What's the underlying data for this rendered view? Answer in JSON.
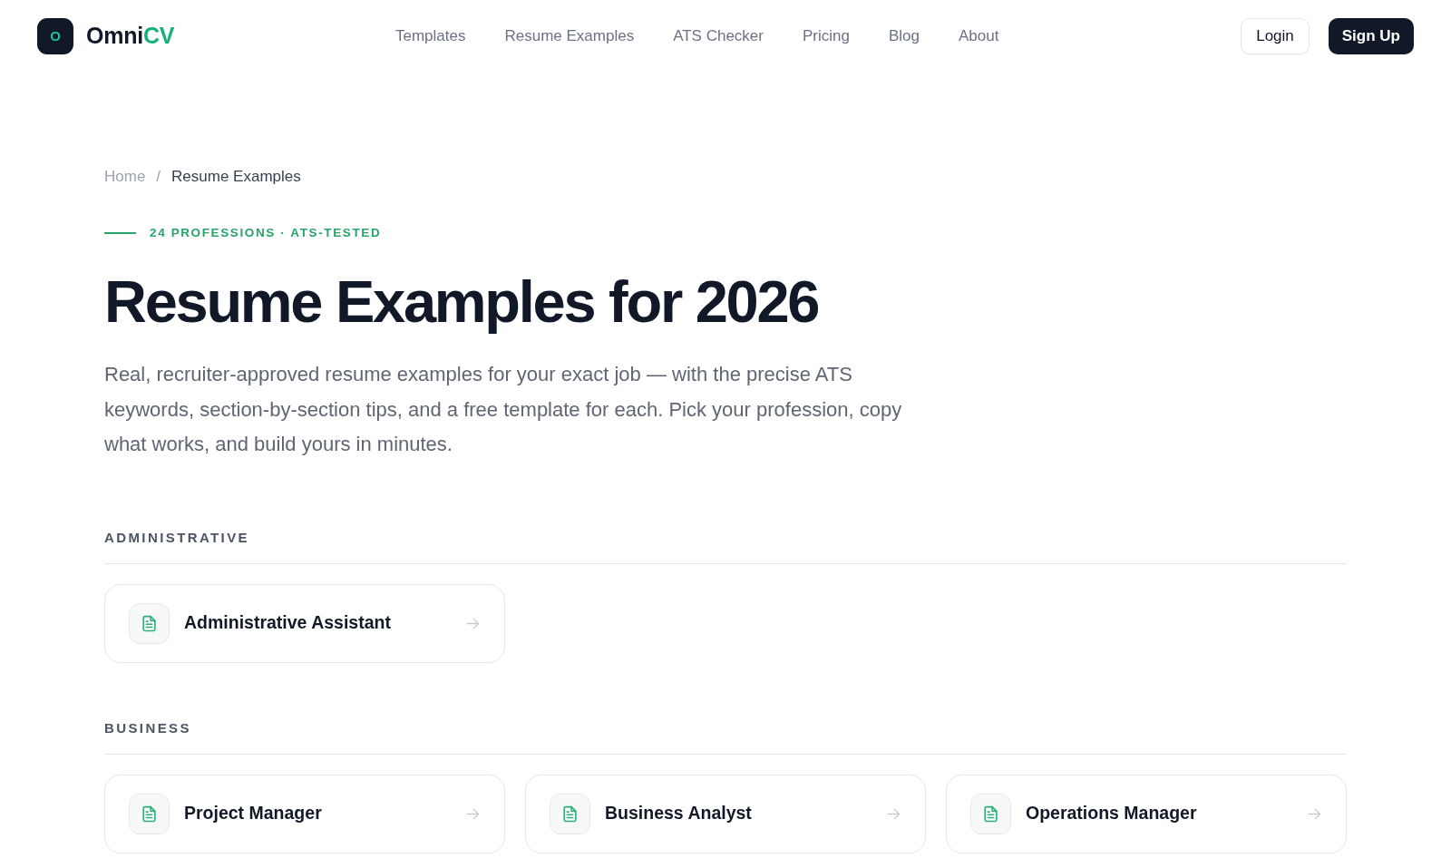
{
  "header": {
    "logo": {
      "mark": "O",
      "name": "Omni",
      "accent": "CV"
    },
    "nav": [
      {
        "label": "Templates"
      },
      {
        "label": "Resume Examples"
      },
      {
        "label": "ATS Checker"
      },
      {
        "label": "Pricing"
      },
      {
        "label": "Blog"
      },
      {
        "label": "About"
      }
    ],
    "login": "Login",
    "signup": "Sign Up"
  },
  "breadcrumb": {
    "separator": "/",
    "items": [
      {
        "label": "Home",
        "current": false
      },
      {
        "label": "Resume Examples",
        "current": true
      }
    ]
  },
  "hero": {
    "eyebrow": "24 PROFESSIONS · ATS-TESTED",
    "title": "Resume Examples for 2026",
    "description": "Real, recruiter-approved resume examples for your exact job — with the precise ATS keywords, section-by-section tips, and a free template for each. Pick your profession, copy what works, and build yours in minutes."
  },
  "sections": [
    {
      "heading": "ADMINISTRATIVE",
      "items": [
        {
          "title": "Administrative Assistant"
        }
      ]
    },
    {
      "heading": "BUSINESS",
      "items": [
        {
          "title": "Project Manager"
        },
        {
          "title": "Business Analyst"
        },
        {
          "title": "Operations Manager"
        }
      ]
    }
  ]
}
